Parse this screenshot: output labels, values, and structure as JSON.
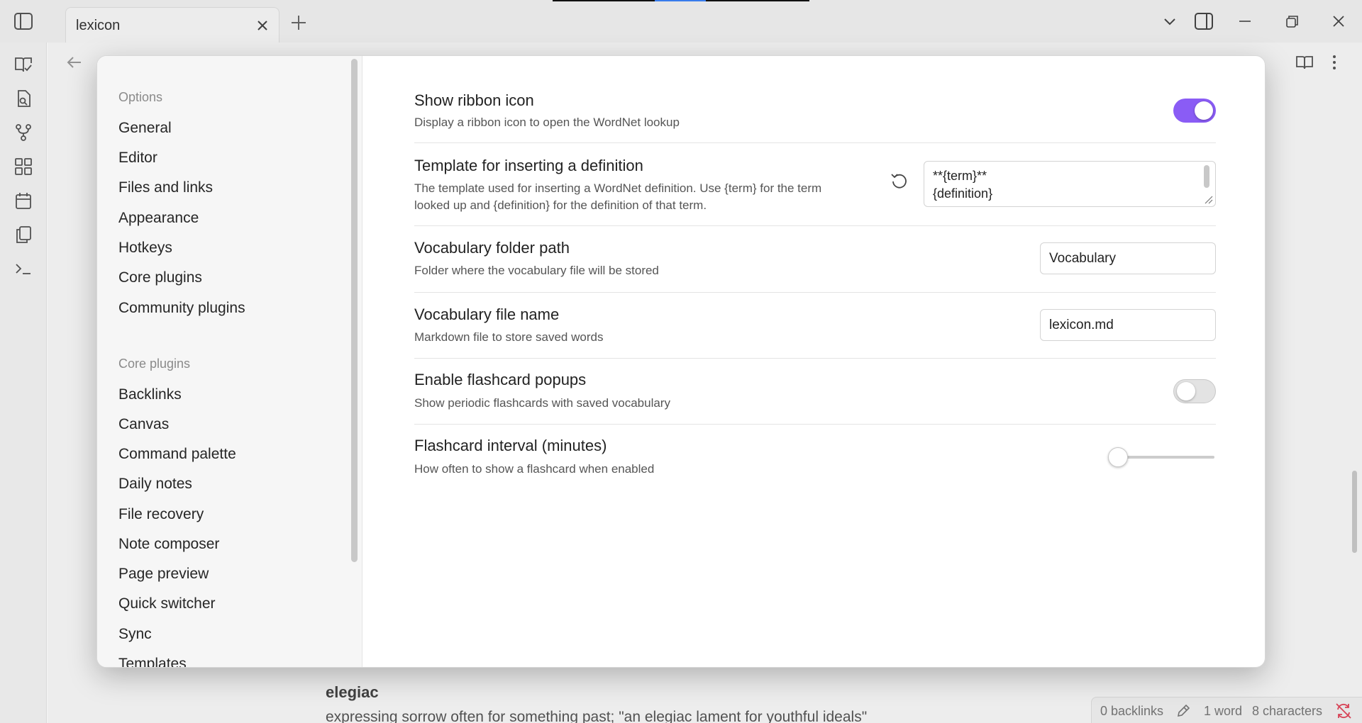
{
  "tab": {
    "title": "lexicon"
  },
  "note": {
    "word": "elegiac",
    "definition": "expressing sorrow often for something past; \"an elegiac lament for youthful ideals\""
  },
  "status": {
    "backlinks": "0 backlinks",
    "words": "1 word",
    "characters": "8 characters"
  },
  "settings_nav": {
    "options_header": "Options",
    "options": [
      "General",
      "Editor",
      "Files and links",
      "Appearance",
      "Hotkeys",
      "Core plugins",
      "Community plugins"
    ],
    "core_header": "Core plugins",
    "core_plugins": [
      "Backlinks",
      "Canvas",
      "Command palette",
      "Daily notes",
      "File recovery",
      "Note composer",
      "Page preview",
      "Quick switcher",
      "Sync",
      "Templates"
    ]
  },
  "settings": {
    "ribbon": {
      "name": "Show ribbon icon",
      "desc": "Display a ribbon icon to open the WordNet lookup",
      "enabled": true
    },
    "template": {
      "name": "Template for inserting a definition",
      "desc_line1": "The template used for inserting a WordNet definition. Use {term} for the term",
      "desc_line2": "looked up and {definition} for the definition of that term.",
      "value_line1": "**{term}**",
      "value_line2": "{definition}"
    },
    "folder": {
      "name": "Vocabulary folder path",
      "desc": "Folder where the vocabulary file will be stored",
      "value": "Vocabulary"
    },
    "file": {
      "name": "Vocabulary file name",
      "desc": "Markdown file to store saved words",
      "value": "lexicon.md"
    },
    "flashcards": {
      "name": "Enable flashcard popups",
      "desc": "Show periodic flashcards with saved vocabulary",
      "enabled": false
    },
    "interval": {
      "name": "Flashcard interval (minutes)",
      "desc": "How often to show a flashcard when enabled",
      "slider_fraction": 0
    }
  },
  "colors": {
    "accent": "#8a5cf5",
    "sync_error": "#e0465a"
  },
  "icons": {
    "ribbon": [
      "vocabulary-check-icon",
      "file-search-icon",
      "graph-icon",
      "grid-icon",
      "calendar-icon",
      "copy-icon",
      "terminal-icon"
    ]
  }
}
